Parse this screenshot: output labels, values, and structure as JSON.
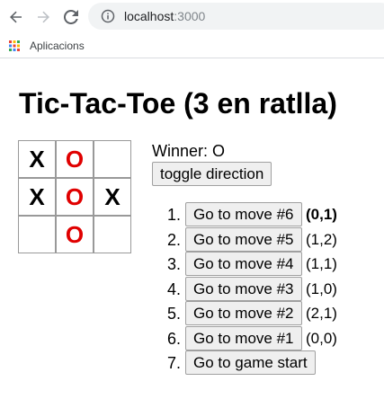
{
  "browser": {
    "url_host": "localhost",
    "url_port": ":3000",
    "bookmarks_apps_label": "Aplicacions"
  },
  "page": {
    "title": "Tic-Tac-Toe (3 en ratlla)",
    "status": "Winner: O",
    "toggle_label": "toggle direction"
  },
  "board": {
    "cells": [
      "X",
      "O",
      "",
      "X",
      "O",
      "X",
      "",
      "O",
      ""
    ]
  },
  "moves": [
    {
      "number": "1.",
      "label": "Go to move #6",
      "coord": "(0,1)",
      "current": true
    },
    {
      "number": "2.",
      "label": "Go to move #5",
      "coord": "(1,2)",
      "current": false
    },
    {
      "number": "3.",
      "label": "Go to move #4",
      "coord": "(1,1)",
      "current": false
    },
    {
      "number": "4.",
      "label": "Go to move #3",
      "coord": "(1,0)",
      "current": false
    },
    {
      "number": "5.",
      "label": "Go to move #2",
      "coord": "(2,1)",
      "current": false
    },
    {
      "number": "6.",
      "label": "Go to move #1",
      "coord": "(0,0)",
      "current": false
    },
    {
      "number": "7.",
      "label": "Go to game start",
      "coord": "",
      "current": false
    }
  ],
  "colors": {
    "x_mark": "#000000",
    "o_mark": "#e00000"
  }
}
